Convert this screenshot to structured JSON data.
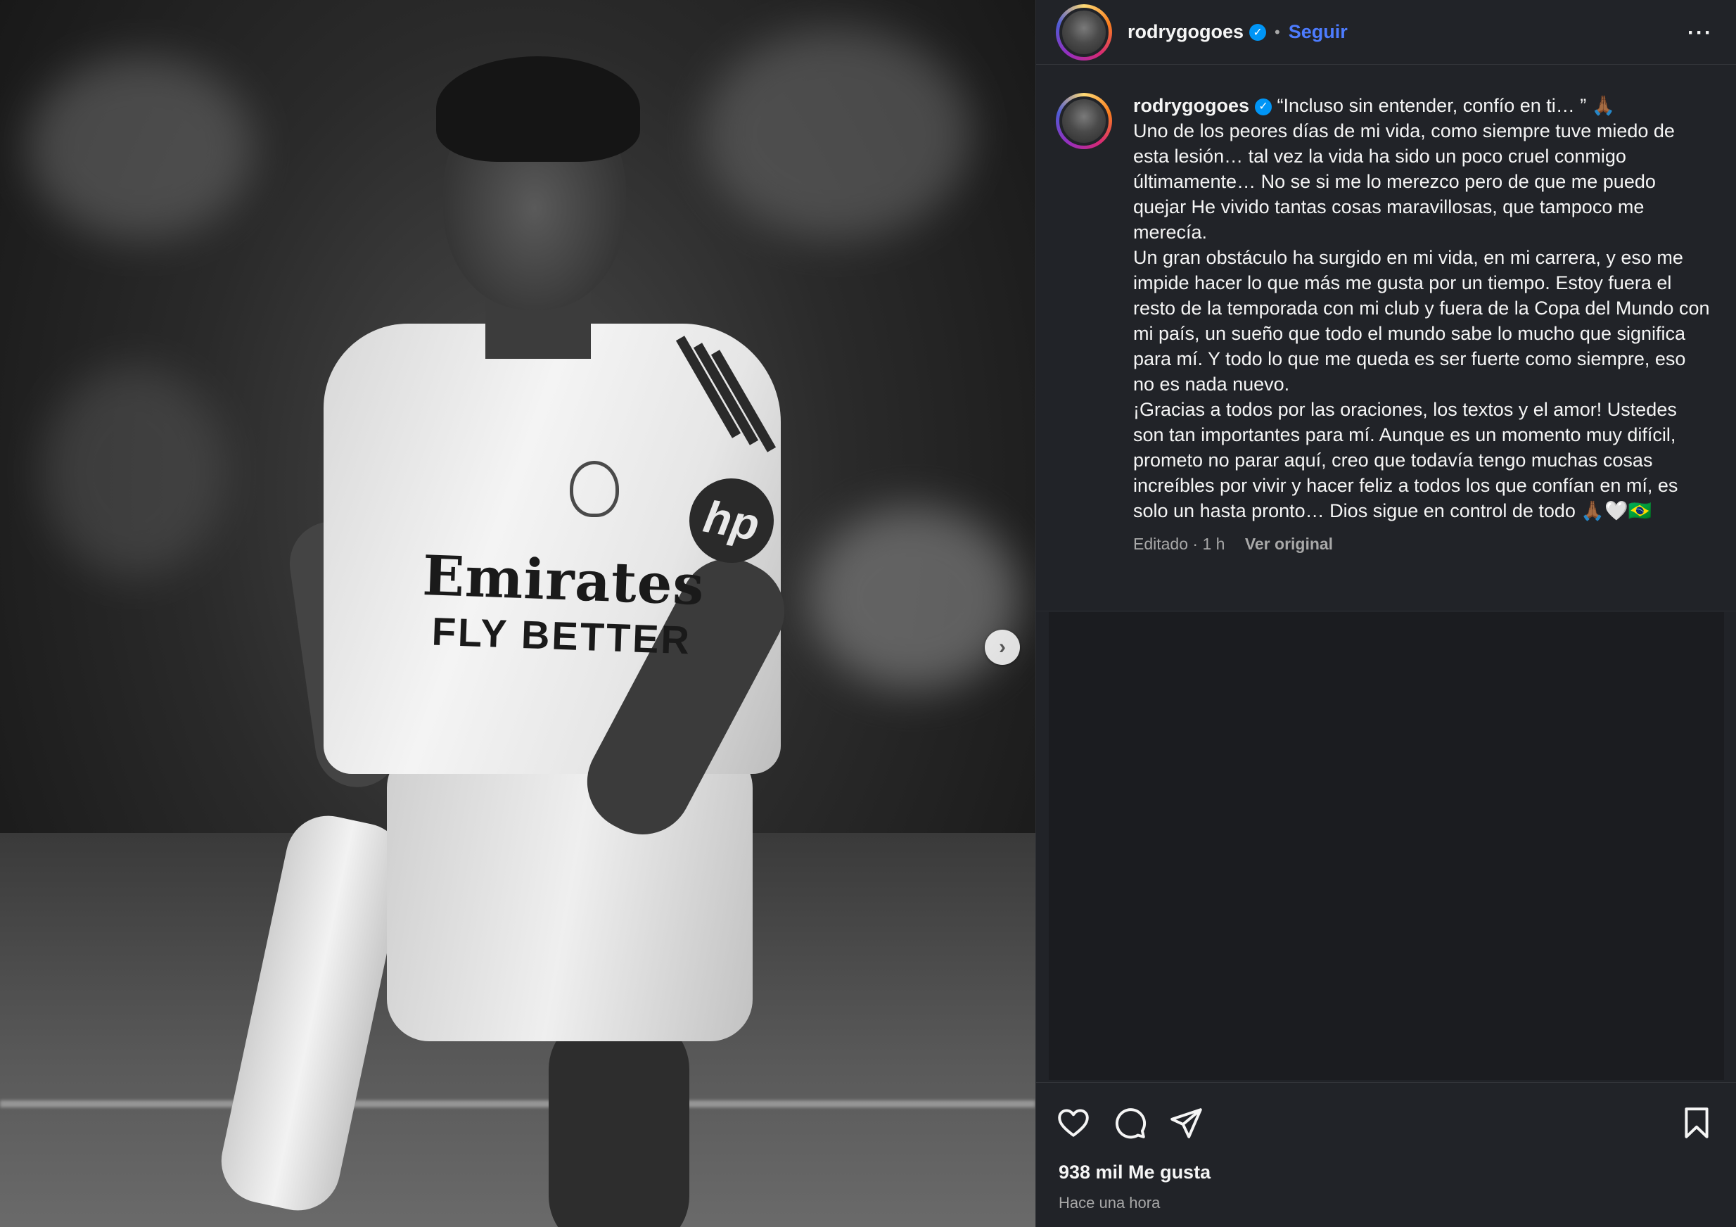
{
  "post": {
    "username": "rodrygogoes",
    "verified_icon": "verified-badge-icon",
    "follow_label": "Seguir",
    "header_separator": "•",
    "more_label": "···",
    "next_label": "›"
  },
  "caption": {
    "username": "rodrygogoes",
    "text": " “Incluso sin entender, confío en ti… ” 🙏🏾\nUno de los peores días de mi vida, como siempre tuve miedo de esta lesión… tal vez la vida ha sido un poco cruel conmigo últimamente… No se si me lo merezco pero de que me puedo quejar He vivido tantas cosas maravillosas, que tampoco me merecía.\nUn gran obstáculo ha surgido en mi vida, en mi carrera, y eso me impide hacer lo que más me gusta por un tiempo. Estoy fuera el resto de la temporada con mi club y fuera de la Copa del Mundo con mi país, un sueño que todo el mundo sabe lo mucho que significa para mí. Y todo lo que me queda es ser fuerte como siempre, eso no es nada nuevo.\n¡Gracias a todos por las oraciones, los textos y el amor! Ustedes son tan importantes para mí. Aunque es un momento muy difícil, prometo no parar aquí, creo que todavía tengo muchas cosas increíbles por vivir y hacer feliz a todos los que confían en mí, es solo un hasta pronto… Dios sigue en control de todo 🙏🏾🤍🇧🇷",
    "edited_label": "Editado · 1 h",
    "see_original_label": "Ver original"
  },
  "photo": {
    "sponsor_line1": "Emirates",
    "sponsor_line2": "FLY BETTER",
    "sleeve_logo": "hp"
  },
  "actions": {
    "icons": [
      "heart-icon",
      "comment-icon",
      "share-icon",
      "bookmark-icon"
    ],
    "likes_label": "938 mil Me gusta",
    "time_label": "Hace una hora"
  },
  "colors": {
    "panel_bg": "#212328",
    "follow_blue": "#4d7cff",
    "verified_blue": "#0095f6",
    "muted_text": "#a8a8a8"
  }
}
